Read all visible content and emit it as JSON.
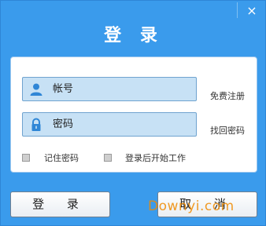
{
  "window": {
    "title": "登 录",
    "close_glyph": "×"
  },
  "form": {
    "account_placeholder": "帐号",
    "password_placeholder": "密码",
    "register_link": "免费注册",
    "forgot_link": "找回密码",
    "remember_label": "记住密码",
    "remember_checked": false,
    "auto_start_label": "登录后开始工作",
    "auto_start_checked": false
  },
  "buttons": {
    "login": "登 录",
    "cancel": "取 消"
  },
  "watermark": "Downyi.com",
  "colors": {
    "window_bg": "#3a9bec",
    "field_bg": "#c7e1f5",
    "watermark": "#f08a00"
  }
}
